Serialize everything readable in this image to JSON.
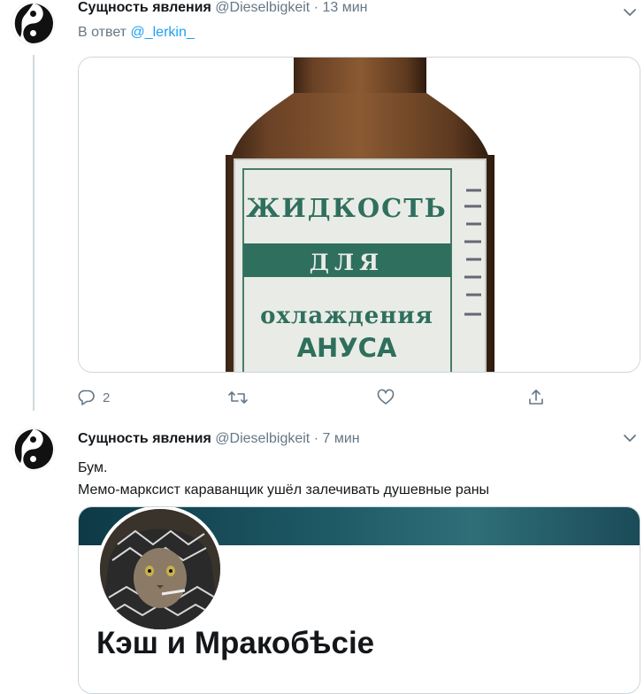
{
  "tweet1": {
    "display_name": "Сущность явления",
    "handle": "@Dieselbigkeit",
    "separator": "·",
    "time": "13 мин",
    "reply_prefix": "В ответ",
    "reply_mention": "@_lerkin_",
    "image_text": {
      "line1": "ЖИДКОСТЬ",
      "line2": "ДЛЯ",
      "line3": "охлаждения",
      "line4": "АНУСА"
    },
    "actions": {
      "reply_count": "2"
    }
  },
  "tweet2": {
    "display_name": "Сущность явления",
    "handle": "@Dieselbigkeit",
    "separator": "·",
    "time": "7 мин",
    "text_line1": "Бум.",
    "text_line2": "Мемо-марксист караванщик ушёл залечивать душевные раны",
    "card_title": "Кэш и Мракобѣсіе"
  },
  "colors": {
    "accent": "#1da1f2",
    "muted": "#657786",
    "border": "#ccd6dd"
  },
  "icons": [
    "yin-yang-avatar-icon",
    "reply-icon",
    "retweet-icon",
    "like-icon",
    "share-icon",
    "chevron-down-icon"
  ]
}
